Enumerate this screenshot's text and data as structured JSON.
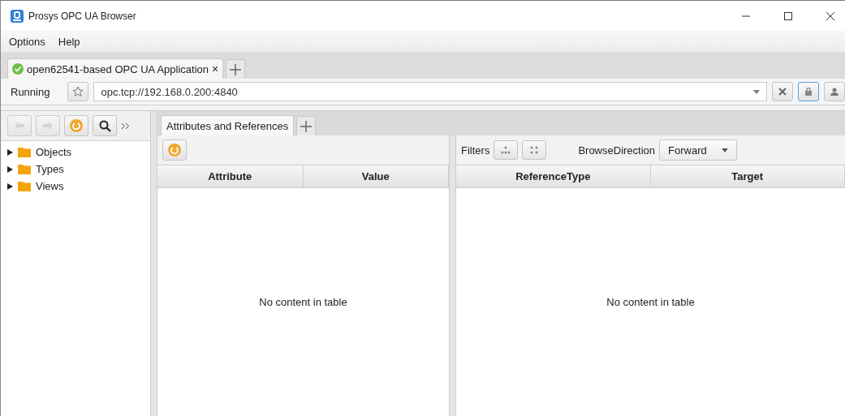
{
  "window": {
    "title": "Prosys OPC UA Browser"
  },
  "menu": [
    "Options",
    "Help"
  ],
  "connection_tabs": [
    {
      "label": "open62541-based OPC UA Application",
      "close": "×",
      "selected": true,
      "connected": true
    }
  ],
  "address_bar": {
    "status": "Running",
    "url": "opc.tcp://192.168.0.200:4840"
  },
  "tree": [
    {
      "label": "Objects",
      "expanded": false
    },
    {
      "label": "Types",
      "expanded": false
    },
    {
      "label": "Views",
      "expanded": false
    }
  ],
  "view_tabs": [
    {
      "label": "Attributes and References",
      "selected": true
    }
  ],
  "attributes": {
    "columns": [
      "Attribute",
      "Value"
    ],
    "empty": "No content in table"
  },
  "references": {
    "filters_label": "Filters",
    "direction_label": "BrowseDirection",
    "direction": "Forward",
    "columns": [
      "ReferenceType",
      "Target"
    ],
    "empty": "No content in table"
  }
}
